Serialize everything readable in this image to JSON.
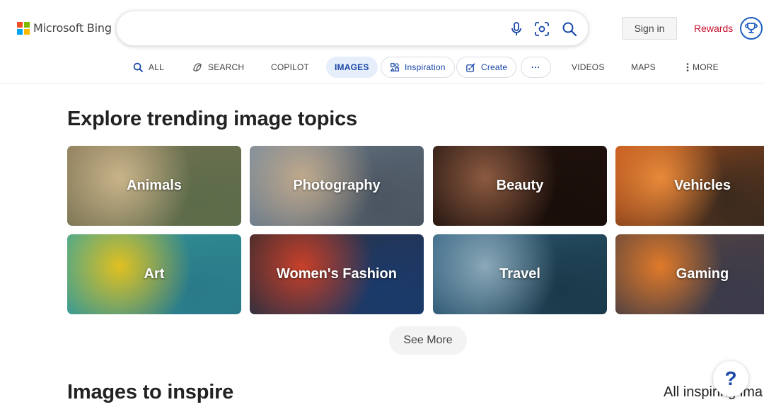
{
  "header": {
    "logo_text": "Microsoft Bing",
    "logo_colors": [
      "#f25022",
      "#7fba00",
      "#00a4ef",
      "#ffb900"
    ],
    "search": {
      "value": "",
      "placeholder": ""
    },
    "icons": [
      "microphone-icon",
      "visual-search-icon",
      "search-icon"
    ],
    "sign_in": "Sign in",
    "rewards": "Rewards",
    "rewards_color": "#c8102e"
  },
  "nav": {
    "items": [
      {
        "label": "ALL",
        "icon": "search-icon"
      },
      {
        "label": "SEARCH",
        "icon": "copilot-search-icon"
      },
      {
        "label": "COPILOT"
      },
      {
        "label": "IMAGES",
        "active": true
      },
      {
        "label": "Inspiration",
        "icon": "inspiration-icon"
      },
      {
        "label": "Create",
        "icon": "create-icon"
      },
      {
        "label": "···"
      },
      {
        "label": "VIDEOS"
      },
      {
        "label": "MAPS"
      },
      {
        "label": "MORE",
        "icon": "kebab-icon"
      }
    ]
  },
  "trending": {
    "title": "Explore trending image topics",
    "tiles": [
      {
        "label": "Animals",
        "colors": [
          "#8a7a5a",
          "#c9b48a",
          "#5c6b4a"
        ]
      },
      {
        "label": "Photography",
        "colors": [
          "#7c8ea0",
          "#c0a98c",
          "#4a5560"
        ]
      },
      {
        "label": "Beauty",
        "colors": [
          "#2a1a14",
          "#8c5a40",
          "#1a0e0a"
        ]
      },
      {
        "label": "Vehicles",
        "colors": [
          "#c85a1e",
          "#e88a3a",
          "#3a2a1e"
        ]
      },
      {
        "label": "Art",
        "colors": [
          "#3aa89c",
          "#e0c020",
          "#2a7a8a"
        ]
      },
      {
        "label": "Women's Fashion",
        "colors": [
          "#3a2a2a",
          "#c8402a",
          "#1a3a6a"
        ]
      },
      {
        "label": "Travel",
        "colors": [
          "#3a6a8a",
          "#8aa8b8",
          "#1a3a4a"
        ]
      },
      {
        "label": "Gaming",
        "colors": [
          "#6a4a3a",
          "#e07a2a",
          "#3a3a4a"
        ]
      }
    ],
    "see_more": "See More"
  },
  "inspire": {
    "title": "Images to inspire",
    "all_inspiring": "All inspiring ima"
  },
  "help": "?"
}
